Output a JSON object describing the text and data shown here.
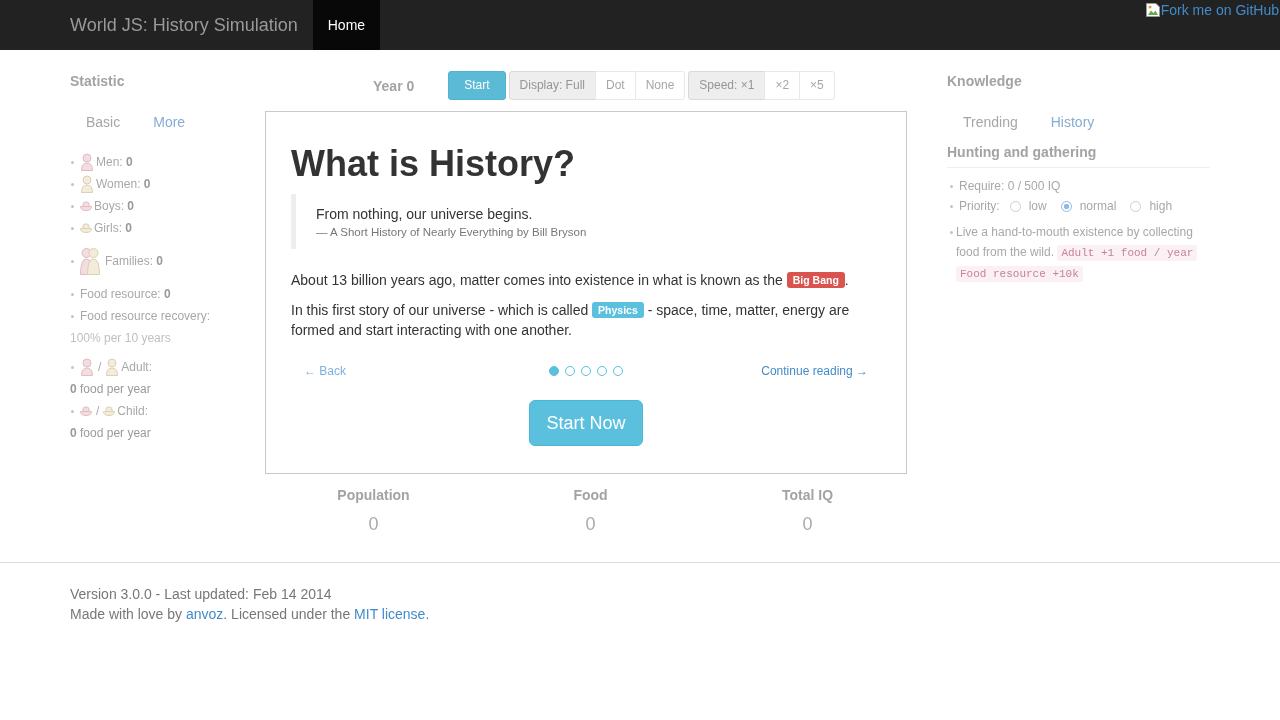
{
  "navbar": {
    "brand": "World JS: History Simulation",
    "items": [
      {
        "label": "Home",
        "selected": true
      }
    ]
  },
  "fork_ribbon": {
    "text": "Fork me on GitHub"
  },
  "statistic": {
    "title": "Statistic",
    "tabs": [
      {
        "label": "Basic",
        "selected": true
      },
      {
        "label": "More",
        "selected": false
      }
    ],
    "groups": [
      {
        "items": [
          {
            "kind": "man",
            "text": "Men: **0**"
          },
          {
            "kind": "woman",
            "text": "Women: **0**"
          },
          {
            "kind": "boy",
            "text": "Boys: **0**"
          },
          {
            "kind": "girl",
            "text": "Girls: **0**"
          }
        ]
      },
      {
        "items": [
          {
            "kind": "family",
            "text": "Families: **0**"
          }
        ]
      },
      {
        "items": [
          {
            "kind": "plain",
            "text": "Food resource: **0**"
          },
          {
            "kind": "plain",
            "text": "Food resource recovery:",
            "note": {
              "text": "100% per 10 years",
              "muted": true
            }
          }
        ]
      },
      {
        "items": [
          {
            "kind": "adult",
            "separator": "/",
            "text": "Adult:",
            "note": {
              "text": "**0** food per year",
              "muted": false
            }
          },
          {
            "kind": "child",
            "separator": "/",
            "text": "Child:",
            "note": {
              "text": "**0** food per year",
              "muted": false
            }
          }
        ]
      }
    ]
  },
  "controls": {
    "year": "Year 0",
    "start_button": "Start",
    "display": [
      {
        "label": "Display: Full",
        "selected": true
      },
      {
        "label": "Dot",
        "selected": false
      },
      {
        "label": "None",
        "selected": false
      }
    ],
    "speed": [
      {
        "label": "Speed: ×1",
        "selected": true
      },
      {
        "label": "×2",
        "selected": false
      },
      {
        "label": "×5",
        "selected": false
      }
    ]
  },
  "story": {
    "title": "What is History?",
    "quote": {
      "text": "From nothing, our universe begins.",
      "source": "— A Short History of Nearly Everything by Bill Bryson"
    },
    "paragraphs": [
      {
        "before": "About 13 billion years ago, matter comes into existence in what is known as the ",
        "tag": {
          "text": "Big Bang",
          "color": "#d9534f"
        },
        "after": "."
      },
      {
        "before": "In this first story of our universe - which is called ",
        "tag": {
          "text": "Physics",
          "color": "#5bc0de"
        },
        "after": " - space, time, matter, energy are formed and start interacting with one another."
      }
    ],
    "back": {
      "text": "← Back",
      "disabled": true
    },
    "steps": [
      {
        "selected": true
      },
      {
        "selected": false
      },
      {
        "selected": false
      },
      {
        "selected": false
      },
      {
        "selected": false
      }
    ],
    "next": {
      "text": "Continue reading →"
    },
    "start_button": "Start Now"
  },
  "totals": [
    {
      "label": "Population",
      "value": "0"
    },
    {
      "label": "Food",
      "value": "0"
    },
    {
      "label": "Total IQ",
      "value": "0"
    }
  ],
  "knowledge": {
    "title": "Knowledge",
    "tabs": [
      {
        "label": "Trending",
        "selected": true
      },
      {
        "label": "History",
        "selected": false
      }
    ],
    "item": {
      "title": "Hunting and gathering",
      "require": "Require: 0 / 500 IQ",
      "priority_label": "Priority:",
      "priorities": [
        {
          "label": "low",
          "selected": false
        },
        {
          "label": "normal",
          "selected": true
        },
        {
          "label": "high",
          "selected": false
        }
      ],
      "description": "Live a hand-to-mouth existence by collecting food from the wild.",
      "effects": [
        "Adult +1 food / year",
        "Food resource +10k"
      ]
    }
  },
  "footer": {
    "version": "Version 3.0.0 - Last updated: Feb 14 2014",
    "credit": {
      "before": "Made with love by ",
      "author": "anvoz",
      "middle": ". Licensed under the ",
      "license": "MIT license",
      "after": "."
    }
  }
}
